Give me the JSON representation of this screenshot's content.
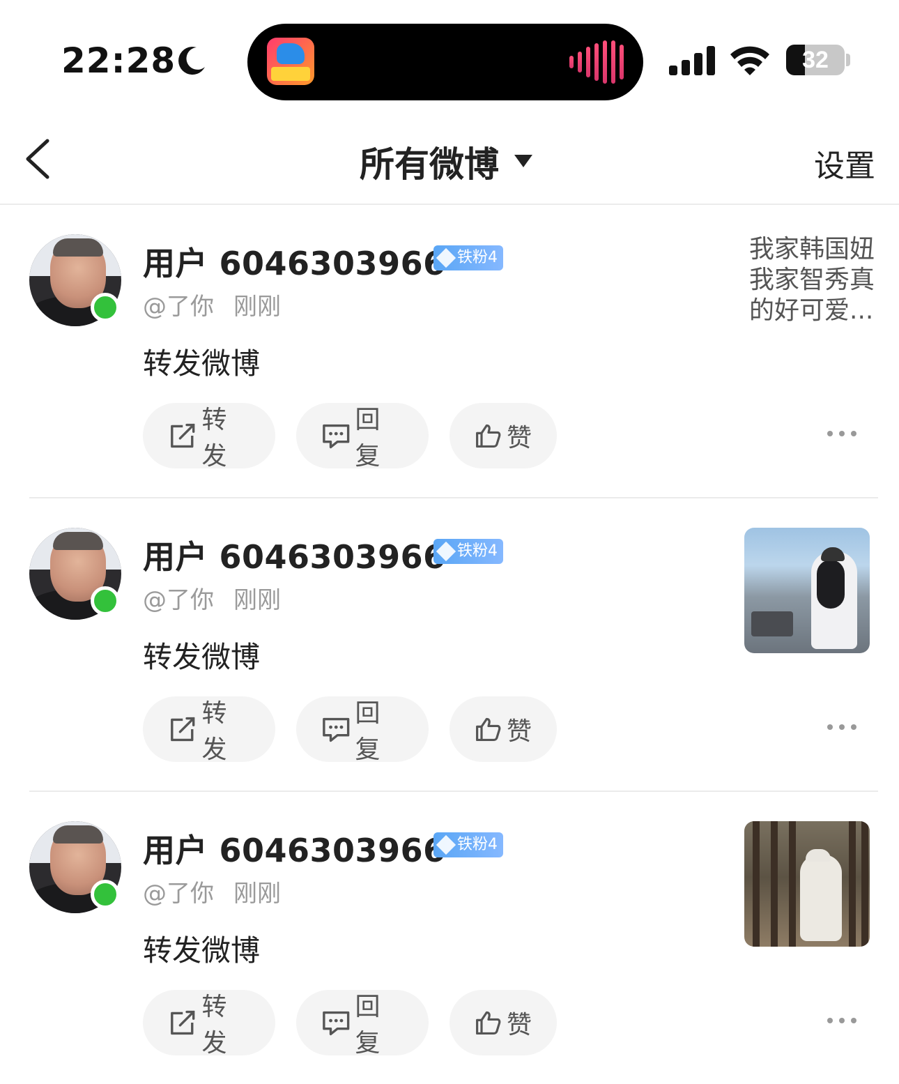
{
  "status": {
    "time": "22:28",
    "battery_level": 32,
    "battery_label": "32"
  },
  "nav": {
    "title": "所有微博",
    "settings_label": "设置"
  },
  "colors": {
    "online": "#33c13b",
    "badge": "#5aa6f5",
    "action_bg": "#f4f4f4"
  },
  "posts": [
    {
      "username": "用户 6046303966",
      "badge": "铁粉4",
      "handle": "@了你",
      "time": "刚刚",
      "content": "转发微博",
      "preview_text": "我家韩国妞我家智秀真的好可爱...",
      "repost_label": "转发",
      "reply_label": "回复",
      "like_label": "赞"
    },
    {
      "username": "用户 6046303966",
      "badge": "铁粉4",
      "handle": "@了你",
      "time": "刚刚",
      "content": "转发微博",
      "repost_label": "转发",
      "reply_label": "回复",
      "like_label": "赞"
    },
    {
      "username": "用户 6046303966",
      "badge": "铁粉4",
      "handle": "@了你",
      "time": "刚刚",
      "content": "转发微博",
      "repost_label": "转发",
      "reply_label": "回复",
      "like_label": "赞"
    }
  ]
}
